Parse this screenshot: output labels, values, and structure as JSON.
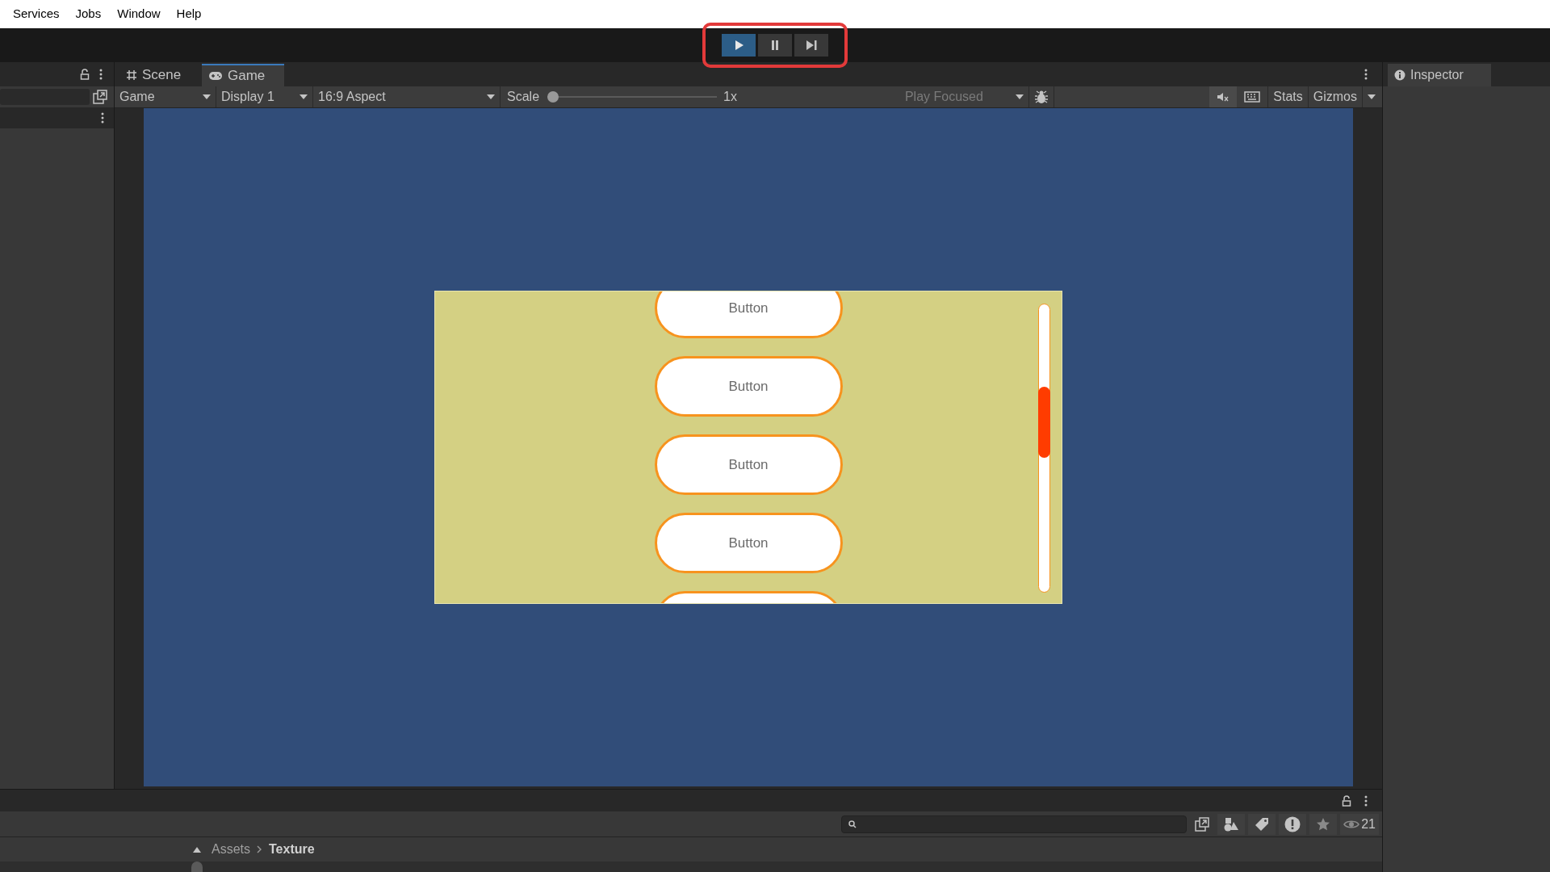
{
  "menu": [
    "Services",
    "Jobs",
    "Window",
    "Help"
  ],
  "play_controls": {
    "highlighted": true,
    "buttons": [
      {
        "kind": "play",
        "on": true
      },
      {
        "kind": "pause",
        "on": false
      },
      {
        "kind": "step",
        "on": false
      }
    ]
  },
  "tabs": [
    {
      "label": "Scene",
      "kind": "scene",
      "selected": false
    },
    {
      "label": "Game",
      "kind": "game",
      "selected": true
    }
  ],
  "inspector_tab": {
    "label": "Inspector"
  },
  "game_toolbar": {
    "view": "Game",
    "display": "Display 1",
    "aspect": "16:9 Aspect",
    "scale_label": "Scale",
    "scale_slider": {
      "level": 0
    },
    "scale_value": "1x",
    "play_mode": "Play Focused",
    "stats": "Stats",
    "gizmos": "Gizmos"
  },
  "game_buttons": [
    {
      "kind": "button",
      "label": "Button"
    },
    {
      "kind": "button",
      "label": "Button"
    },
    {
      "kind": "button",
      "label": "Button"
    },
    {
      "kind": "button",
      "label": "Button"
    },
    {
      "kind": "clipped"
    }
  ],
  "project": {
    "visible_count": "21",
    "breadcrumb": [
      "Assets",
      "Texture"
    ]
  }
}
